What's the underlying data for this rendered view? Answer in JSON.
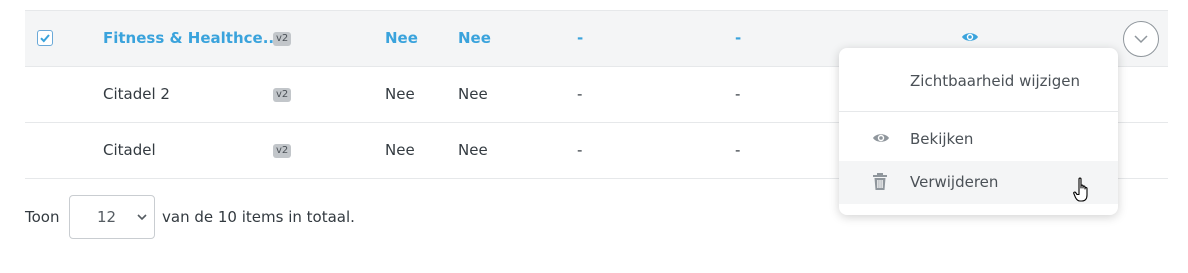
{
  "rows": [
    {
      "name": "Fitness & Healthce...",
      "version": "v2",
      "col_a": "Nee",
      "col_b": "Nee",
      "col_c": "-",
      "col_d": "-"
    },
    {
      "name": "Citadel 2",
      "version": "v2",
      "col_a": "Nee",
      "col_b": "Nee",
      "col_c": "-",
      "col_d": "-"
    },
    {
      "name": "Citadel",
      "version": "v2",
      "col_a": "Nee",
      "col_b": "Nee",
      "col_c": "-",
      "col_d": "-"
    }
  ],
  "footer": {
    "prefix": "Toon",
    "page_size": "12",
    "suffix": "van de 10 items in totaal."
  },
  "menu": {
    "header": "Zichtbaarheid wijzigen",
    "view": "Bekijken",
    "delete": "Verwijderen"
  },
  "colors": {
    "accent": "#3aa3dc",
    "text": "#333a40",
    "selected_row": "#f4f5f6"
  },
  "icons": [
    "checkbox-checked",
    "eye-icon",
    "chevron-down-icon",
    "trash-icon",
    "hand-pointer-cursor"
  ]
}
